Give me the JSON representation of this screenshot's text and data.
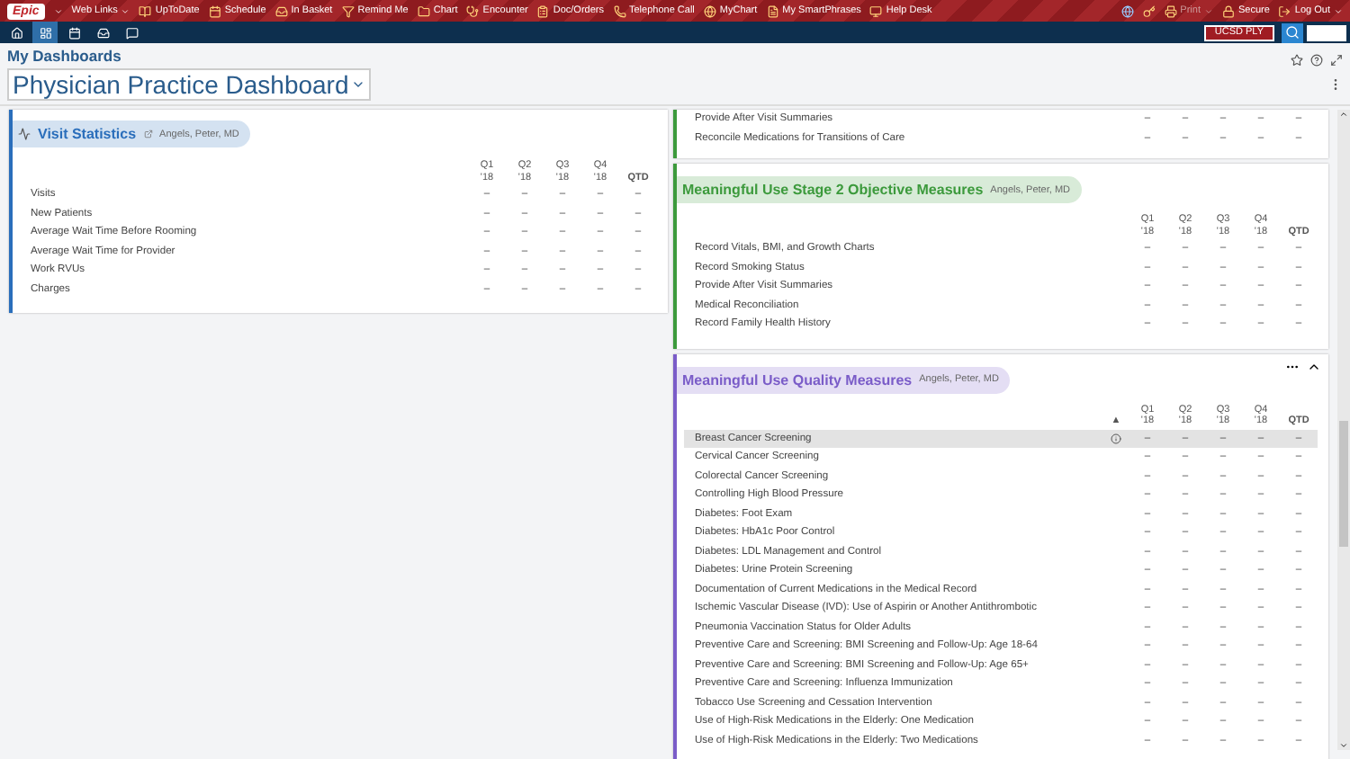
{
  "toolbar": {
    "logo": "Epic",
    "items": [
      {
        "label": "Web Links",
        "kind": "menu"
      },
      {
        "label": "UpToDate",
        "kind": "book"
      },
      {
        "label": "Schedule",
        "kind": "calendar"
      },
      {
        "label": "In Basket",
        "kind": "inbox"
      },
      {
        "label": "Remind Me",
        "kind": "filter"
      },
      {
        "label": "Chart",
        "kind": "folder"
      },
      {
        "label": "Encounter",
        "kind": "stethoscope"
      },
      {
        "label": "Doc/Orders",
        "kind": "clipboard"
      },
      {
        "label": "Telephone Call",
        "kind": "phone"
      },
      {
        "label": "MyChart",
        "kind": "globe"
      },
      {
        "label": "My SmartPhrases",
        "kind": "file"
      },
      {
        "label": "Help Desk",
        "kind": "monitor"
      }
    ],
    "right_items": [
      {
        "label": "Print",
        "kind": "printer",
        "disabled": true
      },
      {
        "label": "Secure",
        "kind": "lock",
        "disabled": false
      },
      {
        "label": "Log Out",
        "kind": "logout",
        "disabled": false
      }
    ]
  },
  "nav": {
    "icons": [
      {
        "kind": "home",
        "selected": false
      },
      {
        "kind": "dashboard",
        "selected": true
      },
      {
        "kind": "calendar",
        "selected": false
      },
      {
        "kind": "inbox",
        "selected": false
      },
      {
        "kind": "chat",
        "selected": false
      }
    ],
    "user": "UCSD PLY"
  },
  "page": {
    "breadcrumb": "My Dashboards",
    "title": "Physician Practice Dashboard"
  },
  "left_panels": [
    {
      "color": "#2a6ebb",
      "title": "Visit Statistics",
      "subtitle": "Angels, Peter, MD",
      "columns": [
        {
          "label": "Q1",
          "year": "'18"
        },
        {
          "label": "Q2",
          "year": "'18"
        },
        {
          "label": "Q3",
          "year": "'18"
        },
        {
          "label": "Q4",
          "year": "'18"
        },
        {
          "label": "QTD"
        }
      ],
      "rows": [
        {
          "label": "Visits",
          "values": [
            "–",
            "–",
            "–",
            "–",
            "–"
          ],
          "selected": false
        },
        {
          "label": "New Patients",
          "values": [
            "–",
            "–",
            "–",
            "–",
            "–"
          ],
          "selected": false
        },
        {
          "label": "Average Wait Time Before Rooming",
          "values": [
            "–",
            "–",
            "–",
            "–",
            "–"
          ],
          "selected": false
        },
        {
          "label": "Average Wait Time for Provider",
          "values": [
            "–",
            "–",
            "–",
            "–",
            "–"
          ],
          "selected": false
        },
        {
          "label": "Work RVUs",
          "values": [
            "–",
            "–",
            "–",
            "–",
            "–"
          ],
          "selected": false
        },
        {
          "label": "Charges",
          "values": [
            "–",
            "–",
            "–",
            "–",
            "–"
          ],
          "selected": false
        }
      ]
    }
  ],
  "right_panels": [
    {
      "color": "#3c9a3c",
      "rows": [
        {
          "label": "Provide After Visit Summaries",
          "values": [
            "–",
            "–",
            "–",
            "–",
            "–"
          ],
          "selected": false
        },
        {
          "label": "Reconcile Medications for Transitions of Care",
          "values": [
            "–",
            "–",
            "–",
            "–",
            "–"
          ],
          "selected": false
        }
      ]
    },
    {
      "color": "#3c9a3c",
      "title": "Meaningful Use Stage 2 Objective Measures",
      "subtitle": "Angels, Peter, MD",
      "columns": [
        {
          "label": "Q1",
          "year": "'18"
        },
        {
          "label": "Q2",
          "year": "'18"
        },
        {
          "label": "Q3",
          "year": "'18"
        },
        {
          "label": "Q4",
          "year": "'18"
        },
        {
          "label": "QTD"
        }
      ],
      "rows": [
        {
          "label": "Record Vitals, BMI, and Growth Charts",
          "values": [
            "–",
            "–",
            "–",
            "–",
            "–"
          ],
          "selected": false
        },
        {
          "label": "Record Smoking Status",
          "values": [
            "–",
            "–",
            "–",
            "–",
            "–"
          ],
          "selected": false
        },
        {
          "label": "Provide After Visit Summaries",
          "values": [
            "–",
            "–",
            "–",
            "–",
            "–"
          ],
          "selected": false
        },
        {
          "label": "Medical Reconciliation",
          "values": [
            "–",
            "–",
            "–",
            "–",
            "–"
          ],
          "selected": false
        },
        {
          "label": "Record Family Health History",
          "values": [
            "–",
            "–",
            "–",
            "–",
            "–"
          ],
          "selected": false
        }
      ]
    },
    {
      "color": "#7a5cc8",
      "title": "Meaningful Use Quality Measures",
      "subtitle": "Angels, Peter, MD",
      "sort_mark": "▲",
      "has_actions": true,
      "columns": [
        {
          "label": "Q1",
          "year": "'18"
        },
        {
          "label": "Q2",
          "year": "'18"
        },
        {
          "label": "Q3",
          "year": "'18"
        },
        {
          "label": "Q4",
          "year": "'18"
        },
        {
          "label": "QTD"
        }
      ],
      "rows": [
        {
          "label": "Breast Cancer Screening",
          "values": [
            "–",
            "–",
            "–",
            "–",
            "–"
          ],
          "selected": true
        },
        {
          "label": "Cervical Cancer Screening",
          "values": [
            "–",
            "–",
            "–",
            "–",
            "–"
          ],
          "selected": false
        },
        {
          "label": "Colorectal Cancer Screening",
          "values": [
            "–",
            "–",
            "–",
            "–",
            "–"
          ],
          "selected": false
        },
        {
          "label": "Controlling High Blood Pressure",
          "values": [
            "–",
            "–",
            "–",
            "–",
            "–"
          ],
          "selected": false
        },
        {
          "label": "Diabetes: Foot Exam",
          "values": [
            "–",
            "–",
            "–",
            "–",
            "–"
          ],
          "selected": false
        },
        {
          "label": "Diabetes: HbA1c Poor Control",
          "values": [
            "–",
            "–",
            "–",
            "–",
            "–"
          ],
          "selected": false
        },
        {
          "label": "Diabetes: LDL Management and Control",
          "values": [
            "–",
            "–",
            "–",
            "–",
            "–"
          ],
          "selected": false
        },
        {
          "label": "Diabetes: Urine Protein Screening",
          "values": [
            "–",
            "–",
            "–",
            "–",
            "–"
          ],
          "selected": false
        },
        {
          "label": "Documentation of Current Medications in the Medical Record",
          "values": [
            "–",
            "–",
            "–",
            "–",
            "–"
          ],
          "selected": false
        },
        {
          "label": "Ischemic Vascular Disease (IVD): Use of Aspirin or Another Antithrombotic",
          "values": [
            "–",
            "–",
            "–",
            "–",
            "–"
          ],
          "selected": false
        },
        {
          "label": "Pneumonia Vaccination Status for Older Adults",
          "values": [
            "–",
            "–",
            "–",
            "–",
            "–"
          ],
          "selected": false
        },
        {
          "label": "Preventive Care and Screening: BMI Screening and Follow-Up: Age 18-64",
          "values": [
            "–",
            "–",
            "–",
            "–",
            "–"
          ],
          "selected": false
        },
        {
          "label": "Preventive Care and Screening: BMI Screening and Follow-Up: Age 65+",
          "values": [
            "–",
            "–",
            "–",
            "–",
            "–"
          ],
          "selected": false
        },
        {
          "label": "Preventive Care and Screening: Influenza Immunization",
          "values": [
            "–",
            "–",
            "–",
            "–",
            "–"
          ],
          "selected": false
        },
        {
          "label": "Tobacco Use Screening and Cessation Intervention",
          "values": [
            "–",
            "–",
            "–",
            "–",
            "–"
          ],
          "selected": false
        },
        {
          "label": "Use of High-Risk Medications in the Elderly: One Medication",
          "values": [
            "–",
            "–",
            "–",
            "–",
            "–"
          ],
          "selected": false
        },
        {
          "label": "Use of High-Risk Medications in the Elderly: Two Medications",
          "values": [
            "–",
            "–",
            "–",
            "–",
            "–"
          ],
          "selected": false
        }
      ]
    }
  ]
}
